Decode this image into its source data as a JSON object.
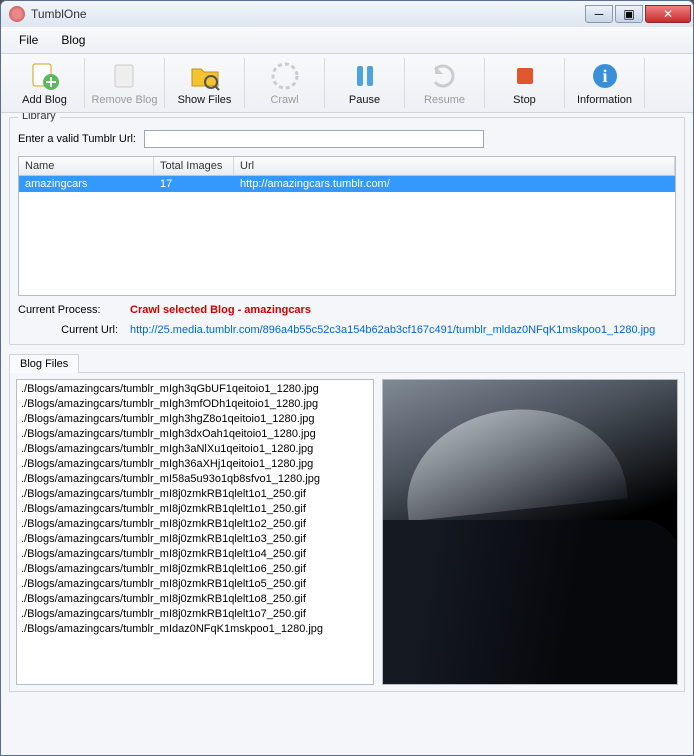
{
  "window": {
    "title": "TumblOne"
  },
  "menu": {
    "file": "File",
    "blog": "Blog"
  },
  "toolbar": {
    "add_blog": "Add Blog",
    "remove_blog": "Remove Blog",
    "show_files": "Show Files",
    "crawl": "Crawl",
    "pause": "Pause",
    "resume": "Resume",
    "stop": "Stop",
    "information": "Information"
  },
  "library": {
    "group_title": "Library",
    "url_label": "Enter a valid Tumblr Url:",
    "url_value": "",
    "columns": {
      "name": "Name",
      "total": "Total Images",
      "url": "Url"
    },
    "rows": [
      {
        "name": "amazingcars",
        "total": "17",
        "url": "http://amazingcars.tumblr.com/"
      }
    ],
    "current_process_label": "Current Process:",
    "current_process_value": "Crawl selected Blog - amazingcars",
    "current_url_label": "Current Url:",
    "current_url_value": "http://25.media.tumblr.com/896a4b55c52c3a154b62ab3cf167c491/tumblr_mldaz0NFqK1mskpoo1_1280.jpg"
  },
  "tabs": {
    "blog_files": "Blog Files",
    "files": [
      "./Blogs/amazingcars/tumblr_mIgh3qGbUF1qeitoio1_1280.jpg",
      "./Blogs/amazingcars/tumblr_mIgh3mfODh1qeitoio1_1280.jpg",
      "./Blogs/amazingcars/tumblr_mIgh3hgZ8o1qeitoio1_1280.jpg",
      "./Blogs/amazingcars/tumblr_mIgh3dxOah1qeitoio1_1280.jpg",
      "./Blogs/amazingcars/tumblr_mIgh3aNlXu1qeitoio1_1280.jpg",
      "./Blogs/amazingcars/tumblr_mIgh36aXHj1qeitoio1_1280.jpg",
      "./Blogs/amazingcars/tumblr_mI58a5u93o1qb8sfvo1_1280.jpg",
      "./Blogs/amazingcars/tumblr_mI8j0zmkRB1qlelt1o1_250.gif",
      "./Blogs/amazingcars/tumblr_mI8j0zmkRB1qlelt1o1_250.gif",
      "./Blogs/amazingcars/tumblr_mI8j0zmkRB1qlelt1o2_250.gif",
      "./Blogs/amazingcars/tumblr_mI8j0zmkRB1qlelt1o3_250.gif",
      "./Blogs/amazingcars/tumblr_mI8j0zmkRB1qlelt1o4_250.gif",
      "./Blogs/amazingcars/tumblr_mI8j0zmkRB1qlelt1o6_250.gif",
      "./Blogs/amazingcars/tumblr_mI8j0zmkRB1qlelt1o5_250.gif",
      "./Blogs/amazingcars/tumblr_mI8j0zmkRB1qlelt1o8_250.gif",
      "./Blogs/amazingcars/tumblr_mI8j0zmkRB1qlelt1o7_250.gif",
      "./Blogs/amazingcars/tumblr_mIdaz0NFqK1mskpoo1_1280.jpg"
    ]
  }
}
